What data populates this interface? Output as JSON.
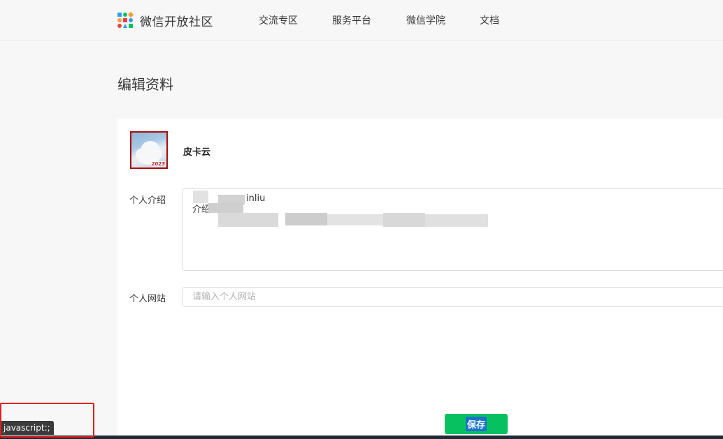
{
  "header": {
    "brand": "微信开放社区",
    "nav": [
      "交流专区",
      "服务平台",
      "微信学院",
      "文档"
    ]
  },
  "page": {
    "title": "编辑资料"
  },
  "profile": {
    "nickname": "皮卡云",
    "avatar_tag": "2023"
  },
  "form": {
    "bio_label": "个人介绍",
    "bio_lines": [
      "inliu",
      "",
      "介绍:"
    ],
    "site_label": "个人网站",
    "site_placeholder": "请输入个人网站",
    "site_value": "",
    "save_label": "保存"
  },
  "status": {
    "link_tip": "javascript:;"
  },
  "colors": {
    "accent": "#07c160",
    "annotation": "#e02020"
  }
}
